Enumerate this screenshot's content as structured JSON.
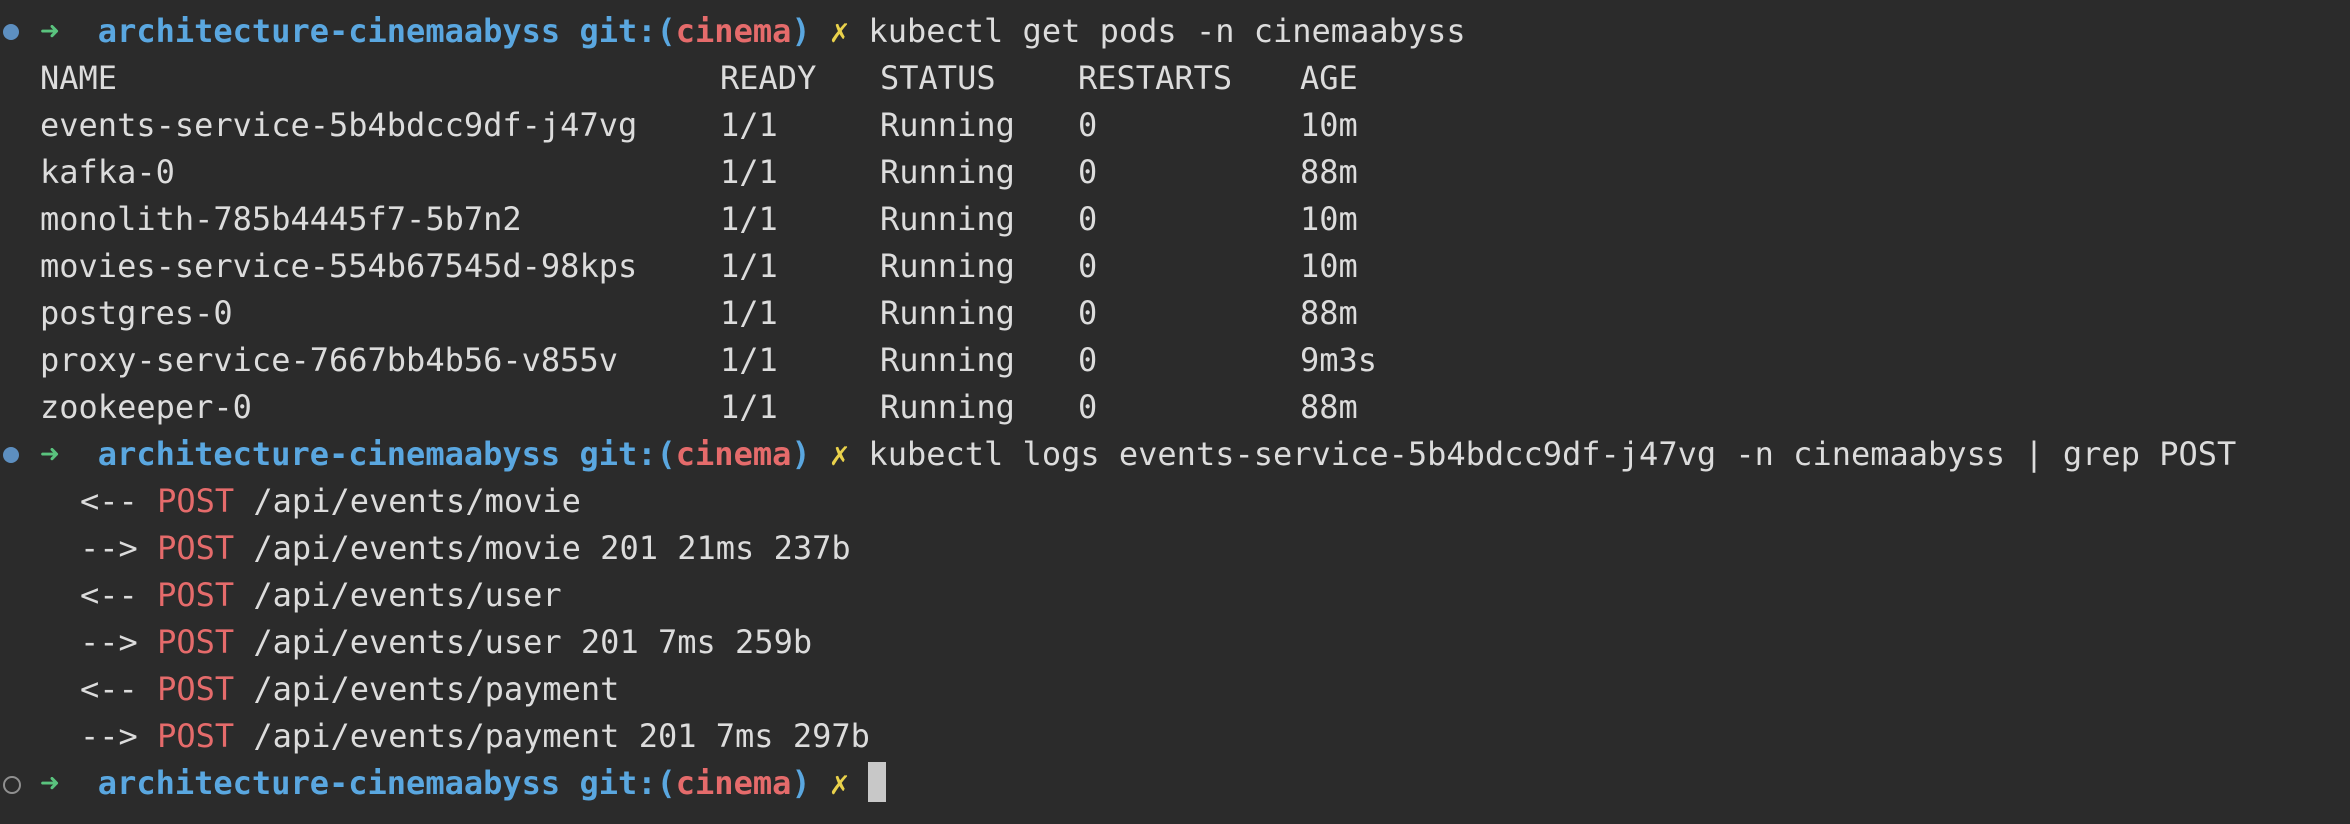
{
  "prompt": {
    "arrow": "➜",
    "dir": "architecture-cinemaabyss",
    "git_label": "git:(",
    "branch": "cinema",
    "git_close": ")",
    "dirty": "✗"
  },
  "commands": [
    "kubectl get pods -n cinemaabyss",
    "kubectl logs events-service-5b4bdcc9df-j47vg -n cinemaabyss | grep POST",
    ""
  ],
  "pods_table": {
    "headers": [
      "NAME",
      "READY",
      "STATUS",
      "RESTARTS",
      "AGE"
    ],
    "rows": [
      [
        "events-service-5b4bdcc9df-j47vg",
        "1/1",
        "Running",
        "0",
        "10m"
      ],
      [
        "kafka-0",
        "1/1",
        "Running",
        "0",
        "88m"
      ],
      [
        "monolith-785b4445f7-5b7n2",
        "1/1",
        "Running",
        "0",
        "10m"
      ],
      [
        "movies-service-554b67545d-98kps",
        "1/1",
        "Running",
        "0",
        "10m"
      ],
      [
        "postgres-0",
        "1/1",
        "Running",
        "0",
        "88m"
      ],
      [
        "proxy-service-7667bb4b56-v855v",
        "1/1",
        "Running",
        "0",
        "9m3s"
      ],
      [
        "zookeeper-0",
        "1/1",
        "Running",
        "0",
        "88m"
      ]
    ]
  },
  "logs": [
    {
      "dir": "<--",
      "method": "POST",
      "rest": " /api/events/movie"
    },
    {
      "dir": "-->",
      "method": "POST",
      "rest": " /api/events/movie 201 21ms 237b"
    },
    {
      "dir": "<--",
      "method": "POST",
      "rest": " /api/events/user"
    },
    {
      "dir": "-->",
      "method": "POST",
      "rest": " /api/events/user 201 7ms 259b"
    },
    {
      "dir": "<--",
      "method": "POST",
      "rest": " /api/events/payment"
    },
    {
      "dir": "-->",
      "method": "POST",
      "rest": " /api/events/payment 201 7ms 297b"
    }
  ],
  "colors": {
    "background": "#2b2b2b",
    "arrow": "#5ac37e",
    "dir": "#5aa7e0",
    "branch": "#e56b6b",
    "dirty": "#e9d14b",
    "post": "#e56b6b"
  }
}
